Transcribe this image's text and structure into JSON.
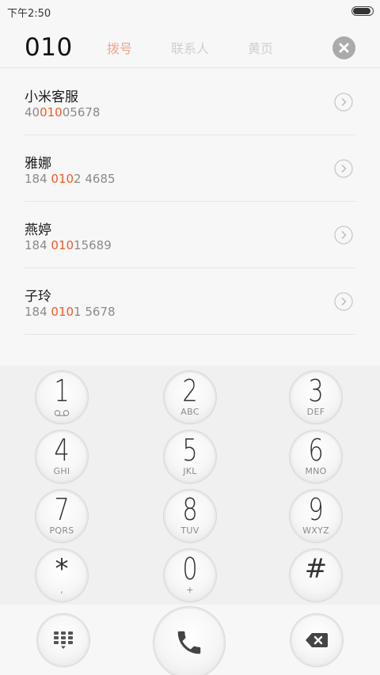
{
  "status_bar": {
    "time": "下午2:50",
    "battery_level": 0.9
  },
  "dialer": {
    "number": "010",
    "tabs": [
      {
        "label": "拨号",
        "active": true
      },
      {
        "label": "联系人",
        "active": false
      },
      {
        "label": "黄页",
        "active": false
      }
    ]
  },
  "results": [
    {
      "name": "小米客服",
      "number_pre": "40",
      "number_match": "010",
      "number_post": "05678"
    },
    {
      "name": "雅娜",
      "number_pre": "184 ",
      "number_match": "010",
      "number_post": "2 4685"
    },
    {
      "name": "燕婷",
      "number_pre": "184 ",
      "number_match": "010",
      "number_post": "15689"
    },
    {
      "name": "子玲",
      "number_pre": "184 ",
      "number_match": "010",
      "number_post": "1 5678"
    }
  ],
  "keypad": [
    {
      "digit": "1",
      "letters": ""
    },
    {
      "digit": "2",
      "letters": "ABC"
    },
    {
      "digit": "3",
      "letters": "DEF"
    },
    {
      "digit": "4",
      "letters": "GHI"
    },
    {
      "digit": "5",
      "letters": "JKL"
    },
    {
      "digit": "6",
      "letters": "MNO"
    },
    {
      "digit": "7",
      "letters": "PQRS"
    },
    {
      "digit": "8",
      "letters": "TUV"
    },
    {
      "digit": "9",
      "letters": "WXYZ"
    },
    {
      "digit": "*",
      "letters": ","
    },
    {
      "digit": "0",
      "letters": "+"
    },
    {
      "digit": "#",
      "letters": ""
    }
  ],
  "icons": {
    "voicemail": "voicemail-icon",
    "dialpad": "dialpad-icon",
    "call": "phone-icon",
    "backspace": "backspace-icon",
    "clear": "close-icon",
    "arrow": "chevron-right-icon"
  },
  "colors": {
    "highlight": "#f05a23",
    "active_tab": "#f4a48c",
    "inactive_tab": "#cfcfcf"
  }
}
